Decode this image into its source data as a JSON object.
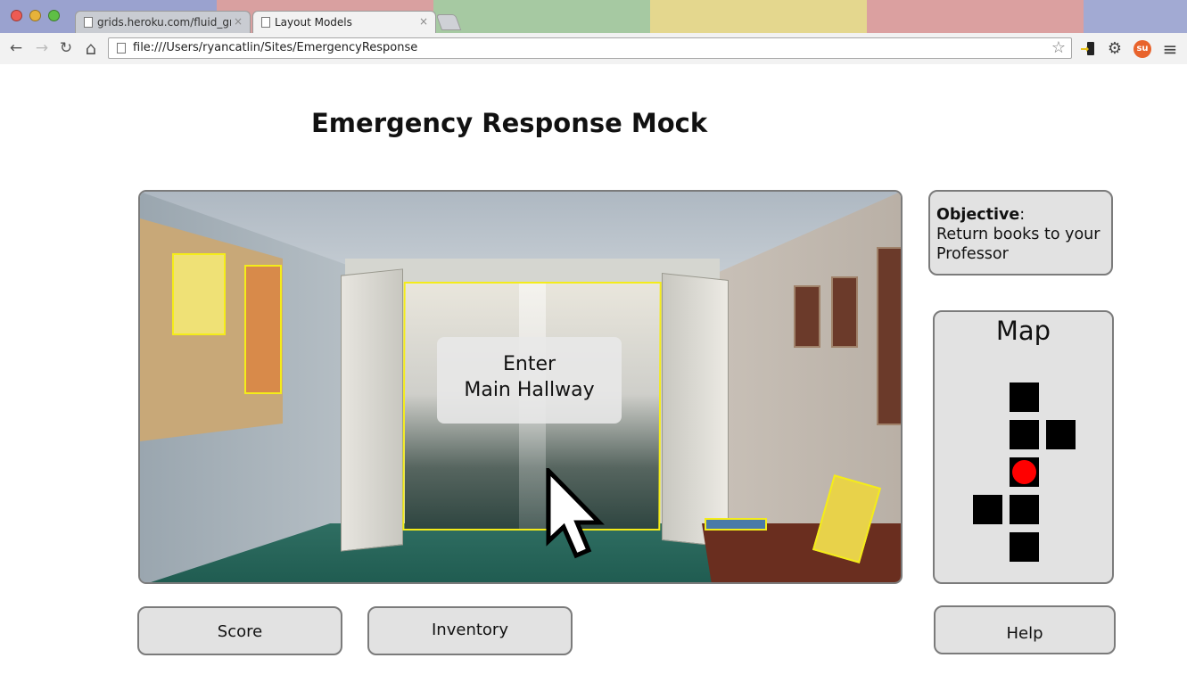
{
  "browser": {
    "tabs": [
      {
        "title": "grids.heroku.com/fluid_grid",
        "active": false
      },
      {
        "title": "Layout Models",
        "active": true
      }
    ],
    "close_glyph": "×",
    "address": "file:///Users/ryancatlin/Sites/EmergencyResponse",
    "nav_icons": {
      "back": "←",
      "forward": "→",
      "reload": "↻",
      "home": "⌂",
      "star": "☆",
      "settings": "⚙",
      "menu": "≡",
      "stumbleupon": "su",
      "cast": "▮"
    },
    "tabstrip_colors": [
      "#8e97c8",
      "#d98c8c",
      "#8ab88a",
      "#e0cf7a",
      "#d98c8c",
      "#8e97c8"
    ]
  },
  "page": {
    "title": "Emergency Response Mock"
  },
  "scene": {
    "hotspot_label_line1": "Enter",
    "hotspot_label_line2": "Main Hallway",
    "highlight_color": "#f4ec1a"
  },
  "objective": {
    "label": "Objective",
    "separator": ":",
    "text": "Return books to your Professor"
  },
  "map": {
    "title": "Map",
    "current_position_color": "#ff0000"
  },
  "buttons": {
    "score": "Score",
    "inventory": "Inventory",
    "help": "Help"
  }
}
